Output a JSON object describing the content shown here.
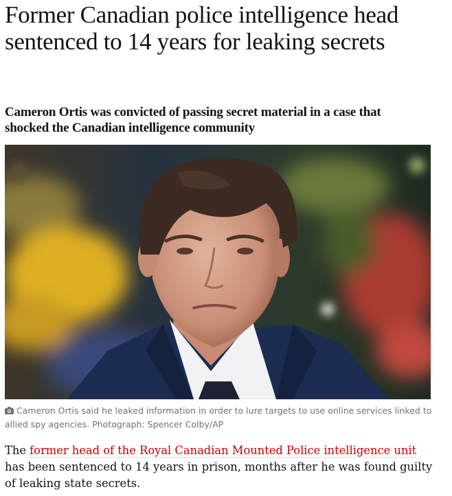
{
  "article": {
    "headline": "Former Canadian police intelligence head sentenced to 14 years for leaking secrets",
    "standfirst": "Cameron Ortis was convicted of passing secret material in a case that shocked the Canadian intelligence community",
    "image": {
      "alt": "Cameron Ortis",
      "caption": "Cameron Ortis said he leaked information in order to lure targets to use online services linked to allied spy agencies.",
      "credit": "Photograph: Spencer Colby/AP",
      "icon": "camera-icon"
    },
    "body": {
      "before_link": "The ",
      "link_text": "former head of the Royal Canadian Mounted Police intelligence unit",
      "after_link": " has been sentenced to 14 years in prison, months after he was found guilty of leaking state secrets."
    }
  },
  "colors": {
    "text": "#121212",
    "link": "#c70000",
    "caption": "#707070"
  }
}
